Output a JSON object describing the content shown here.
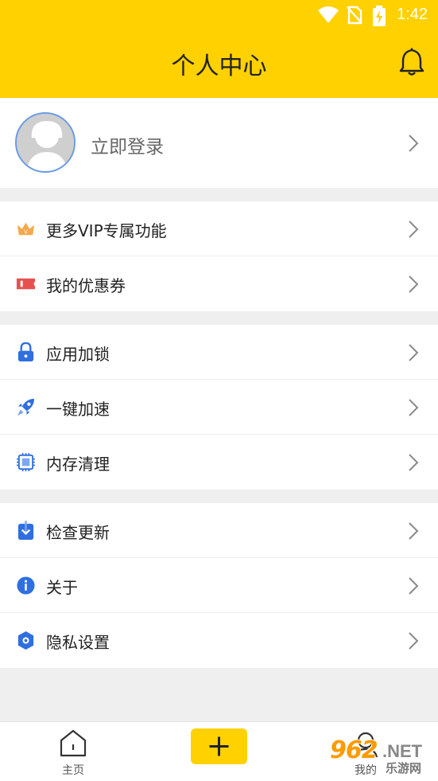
{
  "status_bar": {
    "time": "1:42"
  },
  "header": {
    "title": "个人中心"
  },
  "profile": {
    "login_label": "立即登录"
  },
  "groups": [
    {
      "items": [
        {
          "label": "更多VIP专属功能",
          "icon": "crown-icon"
        },
        {
          "label": "我的优惠券",
          "icon": "coupon-icon"
        }
      ]
    },
    {
      "items": [
        {
          "label": "应用加锁",
          "icon": "lock-icon"
        },
        {
          "label": "一键加速",
          "icon": "rocket-icon"
        },
        {
          "label": "内存清理",
          "icon": "chip-icon"
        }
      ]
    },
    {
      "items": [
        {
          "label": "检查更新",
          "icon": "download-icon"
        },
        {
          "label": "关于",
          "icon": "info-icon"
        },
        {
          "label": "隐私设置",
          "icon": "settings-icon"
        }
      ]
    }
  ],
  "bottom_nav": {
    "home_label": "主页",
    "mine_label": "我的"
  },
  "watermark": {
    "number": "962",
    "suffix": ".NET",
    "site": "乐游网"
  },
  "colors": {
    "accent": "#ffd100",
    "icon_blue": "#2f6fe0",
    "crown": "#f5a84a",
    "coupon": "#e85050"
  }
}
